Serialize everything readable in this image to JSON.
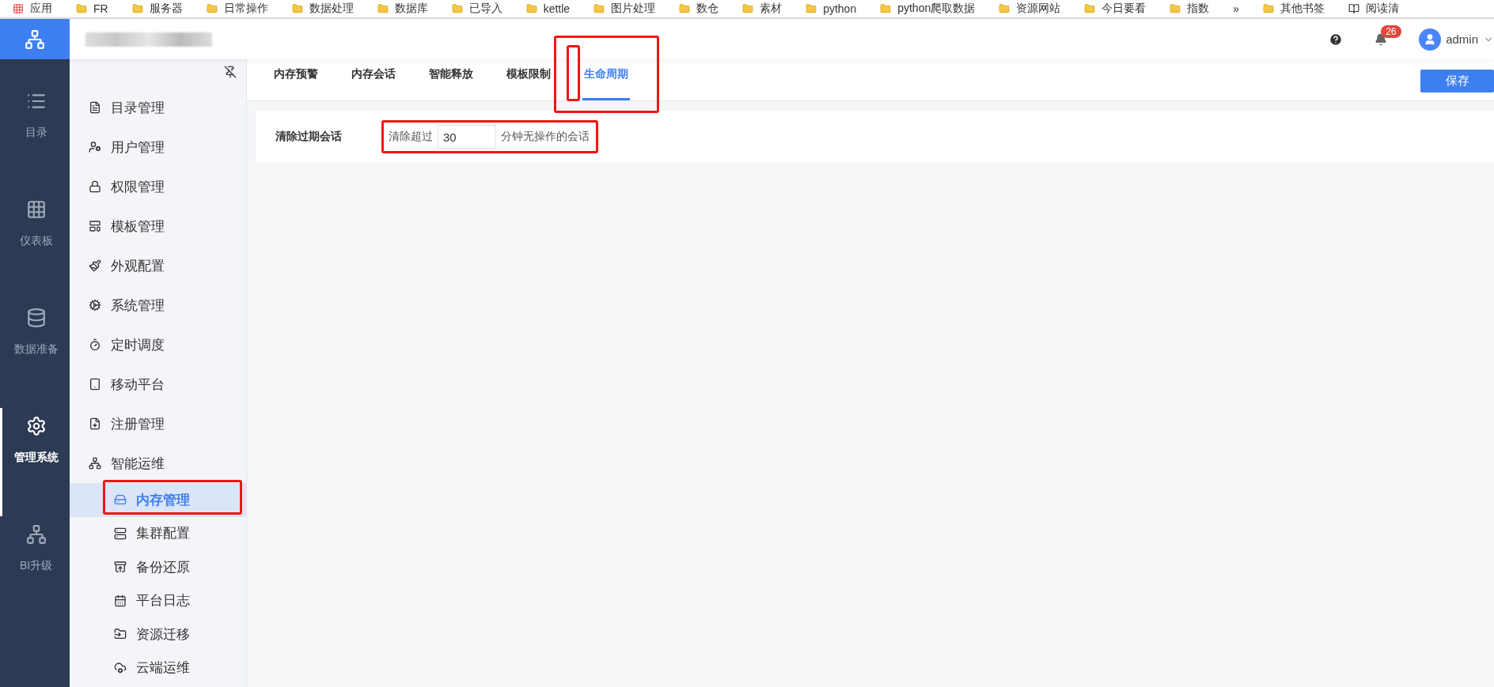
{
  "bookmarks": [
    {
      "label": "应用",
      "kind": "apps"
    },
    {
      "label": "FR",
      "kind": "folder"
    },
    {
      "label": "服务器",
      "kind": "folder"
    },
    {
      "label": "日常操作",
      "kind": "folder"
    },
    {
      "label": "数据处理",
      "kind": "folder"
    },
    {
      "label": "数据库",
      "kind": "folder"
    },
    {
      "label": "已导入",
      "kind": "folder"
    },
    {
      "label": "kettle",
      "kind": "folder"
    },
    {
      "label": "图片处理",
      "kind": "folder"
    },
    {
      "label": "数仓",
      "kind": "folder"
    },
    {
      "label": "素材",
      "kind": "folder"
    },
    {
      "label": "python",
      "kind": "folder"
    },
    {
      "label": "python爬取数据",
      "kind": "folder"
    },
    {
      "label": "资源网站",
      "kind": "folder"
    },
    {
      "label": "今日要看",
      "kind": "folder"
    },
    {
      "label": "指数",
      "kind": "folder"
    },
    {
      "label": "»",
      "kind": "more"
    },
    {
      "label": "其他书签",
      "kind": "folder"
    },
    {
      "label": "阅读清",
      "kind": "reading"
    }
  ],
  "header": {
    "notifications": "26",
    "user": "admin"
  },
  "nav": [
    {
      "label": "目录",
      "selected": false
    },
    {
      "label": "仪表板",
      "selected": false
    },
    {
      "label": "数据准备",
      "selected": false
    },
    {
      "label": "管理系统",
      "selected": true
    },
    {
      "label": "BI升级",
      "selected": false
    }
  ],
  "sidebar": {
    "items": [
      {
        "label": "目录管理",
        "selected": false
      },
      {
        "label": "用户管理",
        "selected": false
      },
      {
        "label": "权限管理",
        "selected": false
      },
      {
        "label": "模板管理",
        "selected": false
      },
      {
        "label": "外观配置",
        "selected": false
      },
      {
        "label": "系统管理",
        "selected": false
      },
      {
        "label": "定时调度",
        "selected": false
      },
      {
        "label": "移动平台",
        "selected": false
      },
      {
        "label": "注册管理",
        "selected": false
      },
      {
        "label": "智能运维",
        "selected": false,
        "children": [
          {
            "label": "内存管理",
            "selected": true
          },
          {
            "label": "集群配置",
            "selected": false
          },
          {
            "label": "备份还原",
            "selected": false
          },
          {
            "label": "平台日志",
            "selected": false
          },
          {
            "label": "资源迁移",
            "selected": false
          },
          {
            "label": "云端运维",
            "selected": false
          }
        ]
      }
    ]
  },
  "tabs": [
    {
      "label": "内存预警",
      "selected": false
    },
    {
      "label": "内存会话",
      "selected": false
    },
    {
      "label": "智能释放",
      "selected": false
    },
    {
      "label": "模板限制",
      "selected": false
    },
    {
      "label": "生命周期",
      "selected": true
    }
  ],
  "save_button": "保存",
  "setting": {
    "label": "清除过期会话",
    "prefix": "清除超过",
    "value": "30",
    "suffix": "分钟无操作的会话"
  }
}
